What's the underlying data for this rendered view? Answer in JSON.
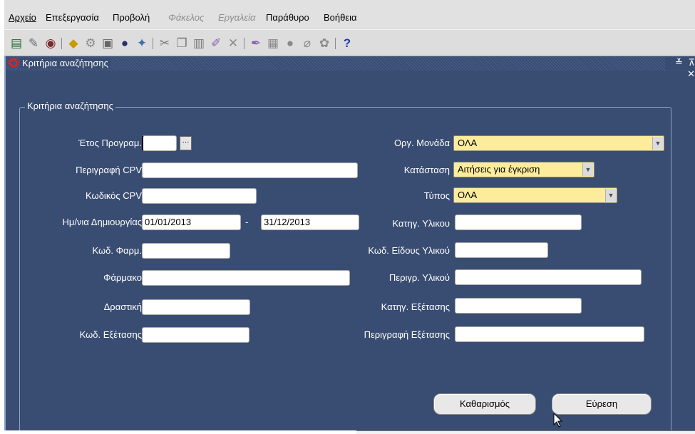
{
  "menu": [
    "Αρχείο",
    "Επεξεργασία",
    "Προβολή",
    "Φάκελος",
    "Εργαλεία",
    "Παράθυρο",
    "Βοήθεια"
  ],
  "toolbar_icons": [
    "new-record-icon",
    "attach-icon",
    "clear-icon",
    "save-icon",
    "open-icon",
    "print-icon",
    "print-preview-icon",
    "find-icon",
    "cut-icon",
    "copy-icon",
    "paste-icon",
    "edit-icon",
    "delete-record-icon",
    "pen-icon",
    "folder-icon",
    "zoom-icon",
    "attachment-icon",
    "translate-icon",
    "help-icon"
  ],
  "window": {
    "title": "Κριτήρια αναζήτησης",
    "controls": "≚ ⊼ ✕"
  },
  "form": {
    "group_title": "Κριτήρια αναζήτησης",
    "fields": {
      "year": {
        "label": "Έτος Προγραμ.",
        "value": ""
      },
      "cpv_desc": {
        "label": "Περιγραφή CPV",
        "value": ""
      },
      "cpv_code": {
        "label": "Κωδικός CPV",
        "value": ""
      },
      "date_created": {
        "label": "Ημ/νια Δημιουργίας",
        "from": "01/01/2013",
        "sep": "-",
        "to": "31/12/2013"
      },
      "pharm_code": {
        "label": "Κωδ. Φαρμ.",
        "value": ""
      },
      "drug": {
        "label": "Φάρμακο",
        "value": ""
      },
      "active": {
        "label": "Δραστική",
        "value": ""
      },
      "exam_code": {
        "label": "Κωδ. Εξέτασης",
        "value": ""
      },
      "org_unit": {
        "label": "Οργ. Μονάδα",
        "value": "ΟΛΑ"
      },
      "status": {
        "label": "Κατάσταση",
        "value": "Αιτήσεις για έγκριση"
      },
      "type": {
        "label": "Τύπος",
        "value": "ΟΛΑ"
      },
      "material_cat": {
        "label": "Κατηγ. Υλικου",
        "value": ""
      },
      "material_kind_code": {
        "label": "Κωδ. Είδους Υλικού",
        "value": ""
      },
      "material_desc": {
        "label": "Περιγρ. Υλικού",
        "value": ""
      },
      "exam_cat": {
        "label": "Κατηγ. Εξέτασης",
        "value": ""
      },
      "exam_desc": {
        "label": "Περιγραφή Εξέτασης",
        "value": ""
      }
    },
    "buttons": {
      "clear": "Καθαρισμός",
      "find": "Εύρεση"
    }
  }
}
